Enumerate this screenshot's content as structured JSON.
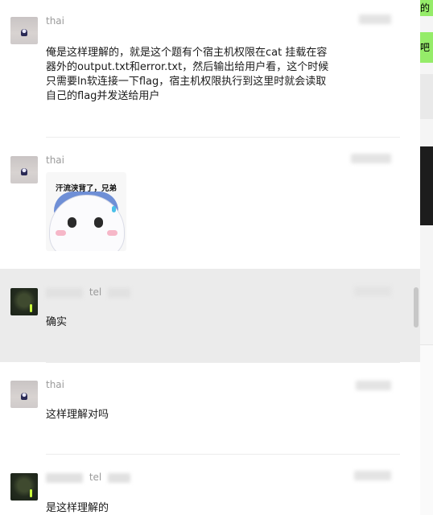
{
  "messages": [
    {
      "sender": "thai",
      "text": "俺是这样理解的，就是这个题有个宿主机权限在cat 挂载在容器外的output.txt和error.txt，然后输出给用户看，这个时候只需要ln软连接一下flag，宿主机权限执行到这里时就会读取自己的flag并发送给用户"
    },
    {
      "sender": "thai",
      "sticker_caption": "汗流浃背了，兄弟"
    },
    {
      "sender_suffix": "tel",
      "text": "确实"
    },
    {
      "sender": "thai",
      "text": "这样理解对吗"
    },
    {
      "sender_suffix": "tel",
      "text": "是这样理解的"
    }
  ],
  "side_panel": {
    "top_text": "的",
    "second_text": "吧"
  },
  "colors": {
    "highlight_row": "#ebebeb",
    "bubble_green": "#95ec69"
  }
}
